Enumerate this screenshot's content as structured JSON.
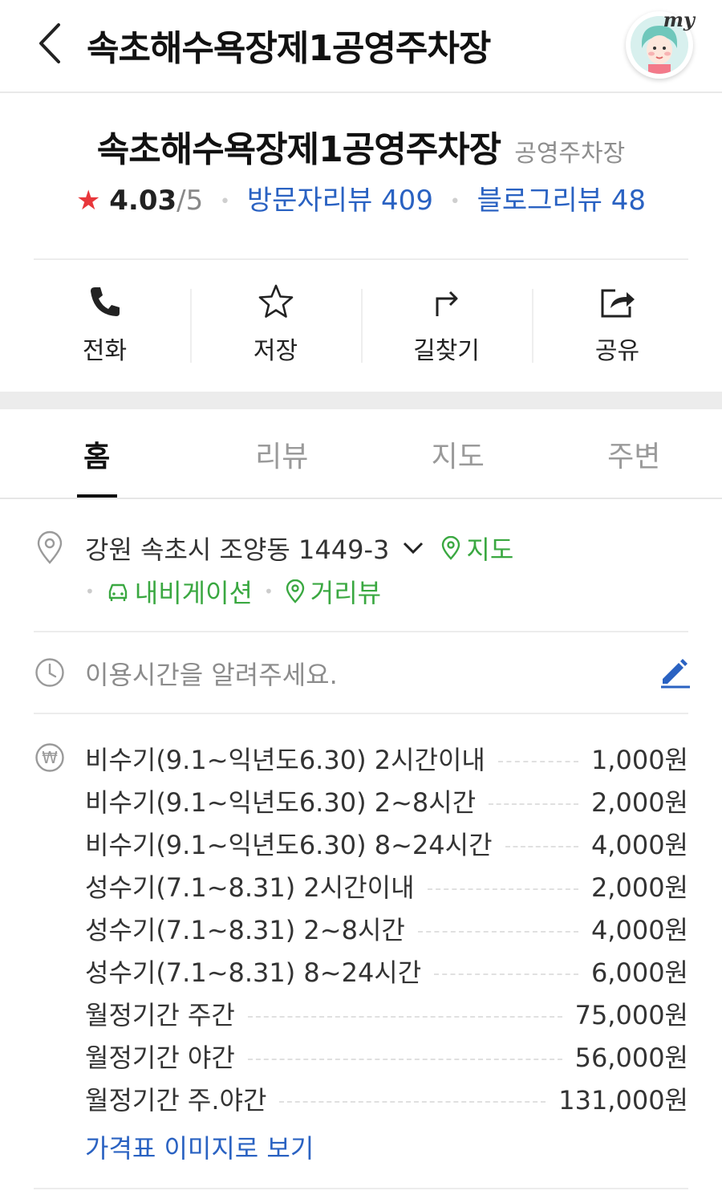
{
  "topbar": {
    "title": "속초해수욕장제1공영주차장",
    "my_label": "my"
  },
  "place": {
    "name": "속초해수욕장제1공영주차장",
    "category": "공영주차장",
    "rating": "4.03",
    "rating_max": "/5",
    "visitor_reviews": "방문자리뷰 409",
    "blog_reviews": "블로그리뷰 48"
  },
  "actions": [
    {
      "label": "전화",
      "icon": "phone-icon"
    },
    {
      "label": "저장",
      "icon": "star-outline-icon"
    },
    {
      "label": "길찾기",
      "icon": "directions-icon"
    },
    {
      "label": "공유",
      "icon": "share-icon"
    }
  ],
  "tabs": [
    {
      "label": "홈",
      "active": true
    },
    {
      "label": "리뷰",
      "active": false
    },
    {
      "label": "지도",
      "active": false
    },
    {
      "label": "주변",
      "active": false
    }
  ],
  "address": {
    "text": "강원 속초시 조양동 1449-3",
    "map_link": "지도",
    "navigation_link": "내비게이션",
    "streetview_link": "거리뷰"
  },
  "hours": {
    "placeholder": "이용시간을 알려주세요."
  },
  "prices": [
    {
      "label": "비수기(9.1~익년도6.30) 2시간이내",
      "price": "1,000원"
    },
    {
      "label": "비수기(9.1~익년도6.30) 2~8시간",
      "price": "2,000원"
    },
    {
      "label": "비수기(9.1~익년도6.30) 8~24시간",
      "price": "4,000원"
    },
    {
      "label": "성수기(7.1~8.31) 2시간이내",
      "price": "2,000원"
    },
    {
      "label": "성수기(7.1~8.31) 2~8시간",
      "price": "4,000원"
    },
    {
      "label": "성수기(7.1~8.31) 8~24시간",
      "price": "6,000원"
    },
    {
      "label": "월정기간 주간",
      "price": "75,000원"
    },
    {
      "label": "월정기간 야간",
      "price": "56,000원"
    },
    {
      "label": "월정기간 주.야간",
      "price": "131,000원"
    }
  ],
  "price_image_link": "가격표 이미지로 보기",
  "colors": {
    "star": "#e8373b",
    "link_blue": "#2a62c2",
    "link_green": "#3aa841"
  }
}
